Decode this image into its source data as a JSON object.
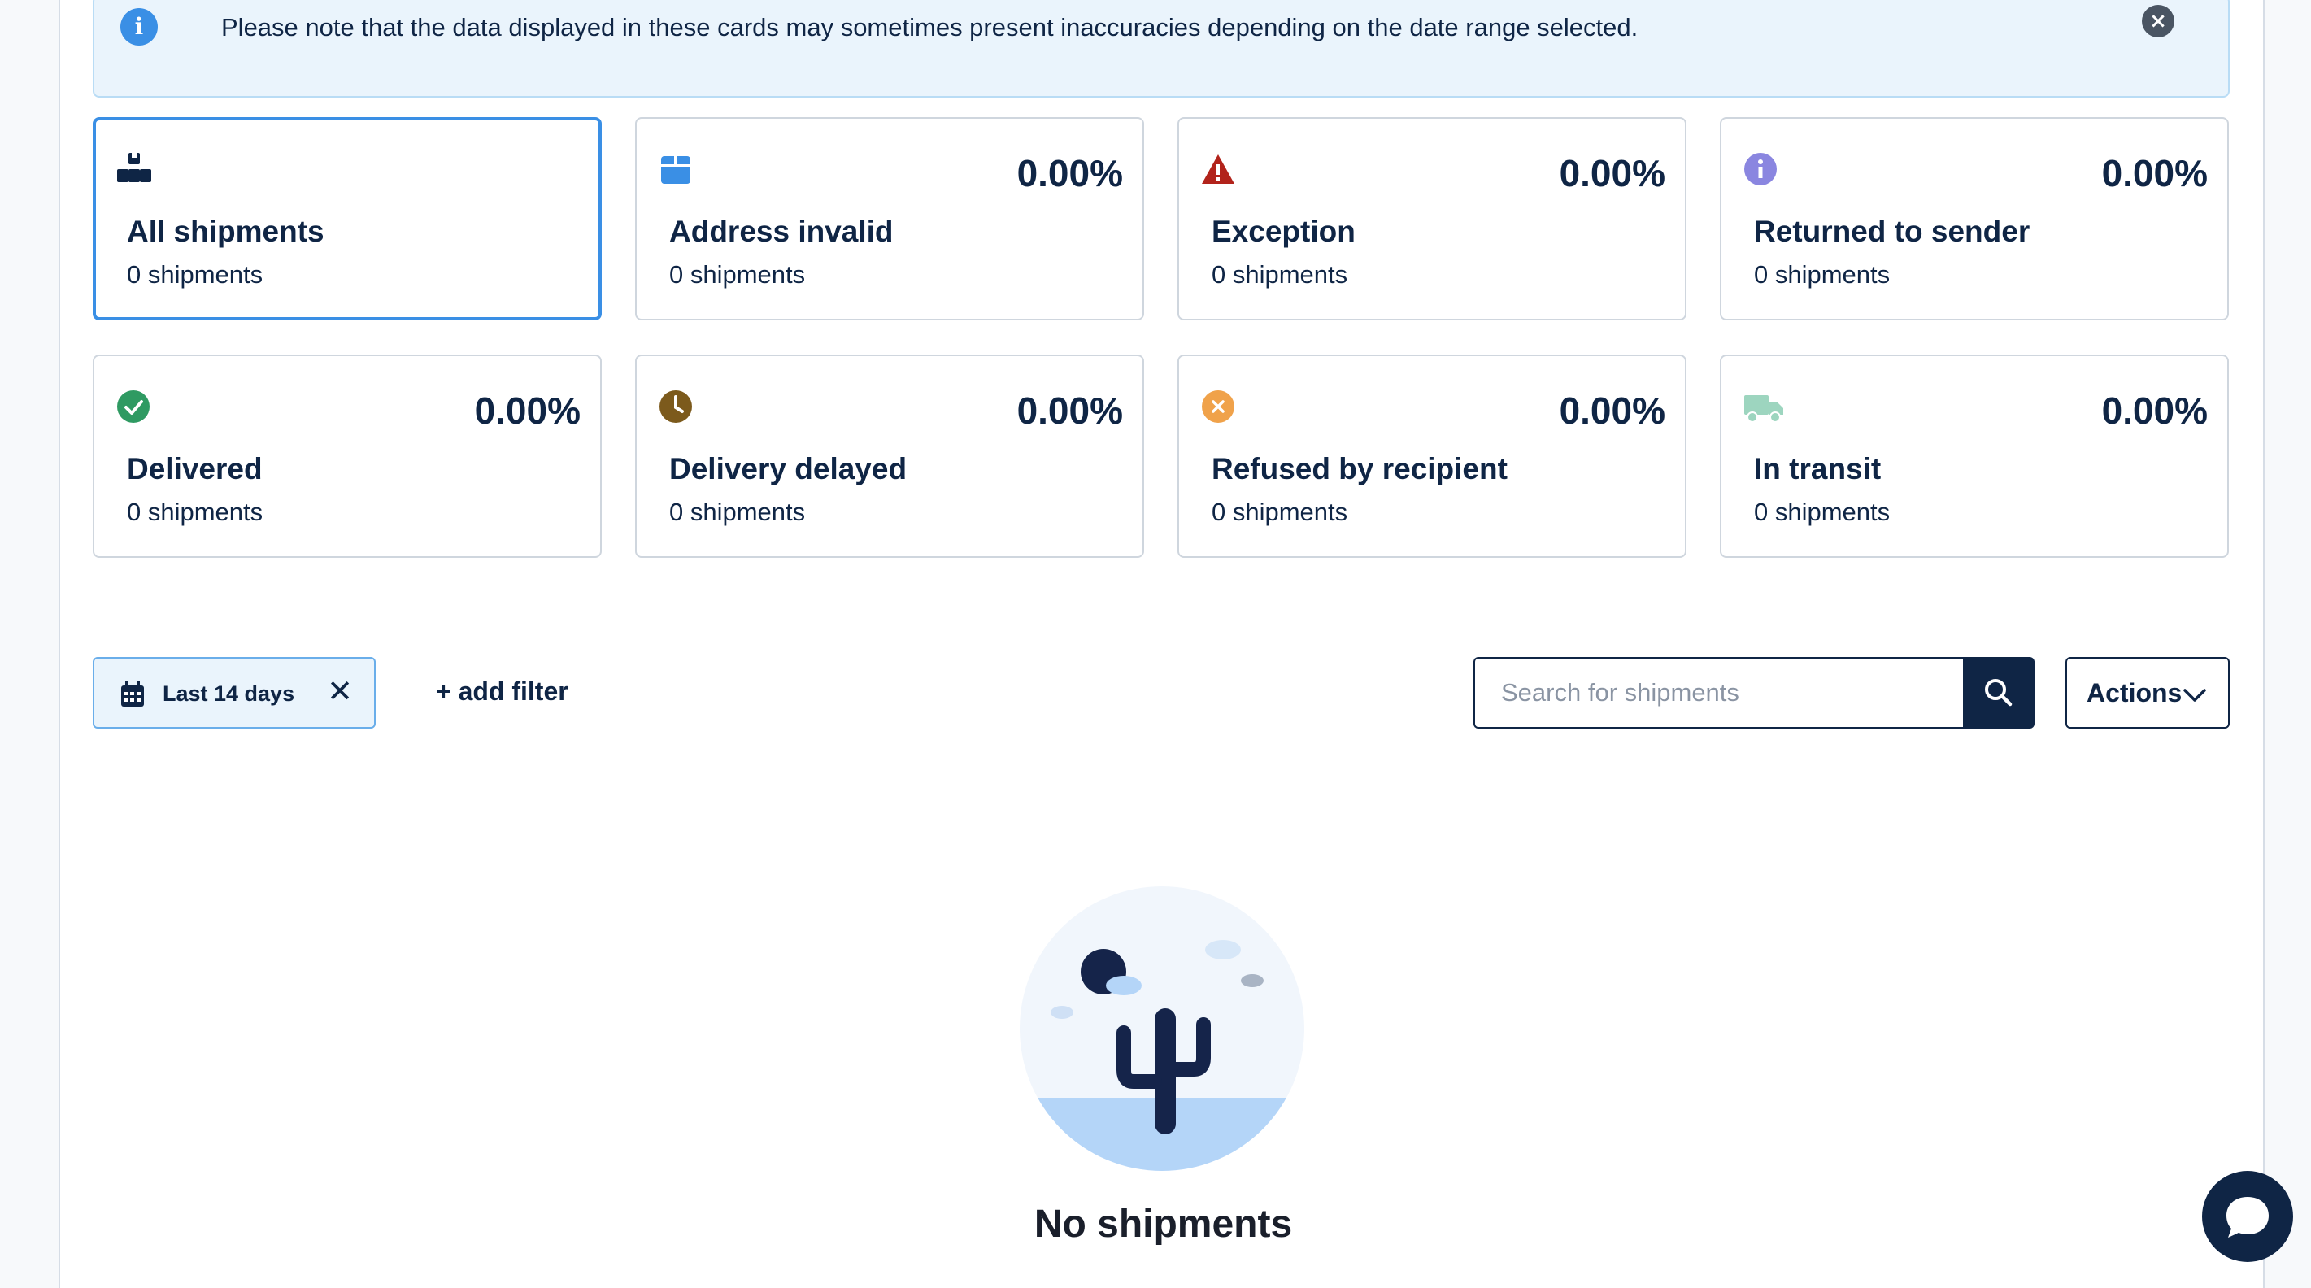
{
  "notice": {
    "text": "Please note that the data displayed in these cards may sometimes present inaccuracies depending on the date range selected.",
    "close_glyph": "×"
  },
  "cards": [
    {
      "title": "All shipments",
      "count": "0 shipments",
      "percent": "",
      "icon": "boxes-icon",
      "selected": true
    },
    {
      "title": "Address invalid",
      "count": "0 shipments",
      "percent": "0.00%",
      "icon": "package-icon",
      "color": "#3a8fe5"
    },
    {
      "title": "Exception",
      "count": "0 shipments",
      "percent": "0.00%",
      "icon": "warning-icon",
      "color": "#b2231b"
    },
    {
      "title": "Returned to sender",
      "count": "0 shipments",
      "percent": "0.00%",
      "icon": "info-icon",
      "color": "#8a86e0"
    },
    {
      "title": "Delivered",
      "count": "0 shipments",
      "percent": "0.00%",
      "icon": "check-circle-icon",
      "color": "#2f9a62"
    },
    {
      "title": "Delivery delayed",
      "count": "0 shipments",
      "percent": "0.00%",
      "icon": "clock-icon",
      "color": "#7c5a1c"
    },
    {
      "title": "Refused by recipient",
      "count": "0 shipments",
      "percent": "0.00%",
      "icon": "x-circle-icon",
      "color": "#f0a24a"
    },
    {
      "title": "In transit",
      "count": "0 shipments",
      "percent": "0.00%",
      "icon": "truck-icon",
      "color": "#9dd5bf"
    }
  ],
  "filters": {
    "date_chip_label": "Last 14 days",
    "add_filter_label": "+ add filter"
  },
  "search": {
    "placeholder": "Search for shipments"
  },
  "actions": {
    "label": "Actions"
  },
  "empty_state": {
    "title": "No shipments"
  },
  "colors": {
    "navy": "#0f2545",
    "accent_blue": "#3a8fe5",
    "notice_bg": "#eaf4fc"
  }
}
